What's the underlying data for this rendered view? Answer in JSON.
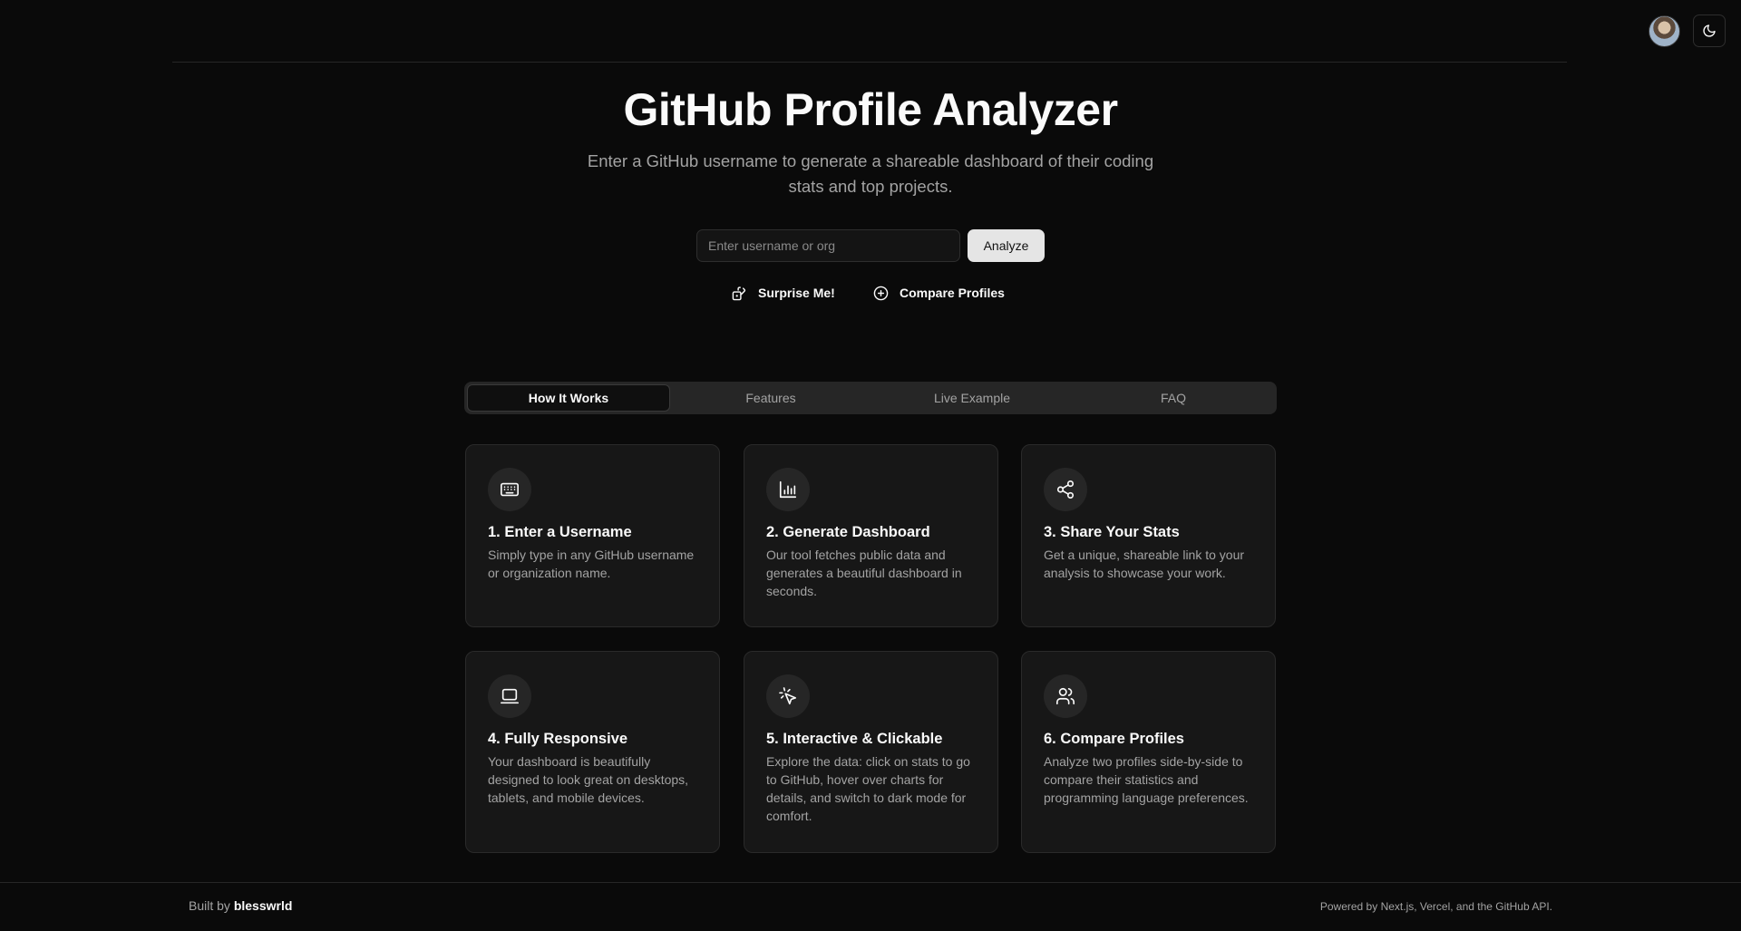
{
  "header": {
    "avatar_alt": "User avatar",
    "theme_icon": "moon-icon"
  },
  "hero": {
    "title": "GitHub Profile Analyzer",
    "subtitle": "Enter a GitHub username to generate a shareable dashboard of their coding stats and top projects."
  },
  "search": {
    "placeholder": "Enter username or org",
    "value": "",
    "button_label": "Analyze"
  },
  "actions": {
    "surprise_label": "Surprise Me!",
    "surprise_icon": "dice-icon",
    "compare_label": "Compare Profiles",
    "compare_icon": "plus-circle-icon"
  },
  "tabs": [
    {
      "label": "How It Works",
      "active": true
    },
    {
      "label": "Features",
      "active": false
    },
    {
      "label": "Live Example",
      "active": false
    },
    {
      "label": "FAQ",
      "active": false
    }
  ],
  "steps": [
    {
      "title": "1. Enter a Username",
      "desc": "Simply type in any GitHub username or organization name.",
      "icon": "keyboard-icon"
    },
    {
      "title": "2. Generate Dashboard",
      "desc": "Our tool fetches public data and generates a beautiful dashboard in seconds.",
      "icon": "bar-chart-icon"
    },
    {
      "title": "3. Share Your Stats",
      "desc": "Get a unique, shareable link to your analysis to showcase your work.",
      "icon": "share-icon"
    },
    {
      "title": "4. Fully Responsive",
      "desc": "Your dashboard is beautifully designed to look great on desktops, tablets, and mobile devices.",
      "icon": "laptop-icon"
    },
    {
      "title": "5. Interactive & Clickable",
      "desc": "Explore the data: click on stats to go to GitHub, hover over charts for details, and switch to dark mode for comfort.",
      "icon": "pointer-click-icon"
    },
    {
      "title": "6. Compare Profiles",
      "desc": "Analyze two profiles side-by-side to compare their statistics and programming language preferences.",
      "icon": "users-icon"
    }
  ],
  "footer": {
    "built_prefix": "Built by",
    "author": "blesswrld",
    "powered": "Powered by Next.js, Vercel, and the GitHub API."
  },
  "colors": {
    "background": "#0a0a0a",
    "card": "#171717",
    "muted_text": "#a3a3a3",
    "primary_button": "#e5e5e5"
  }
}
